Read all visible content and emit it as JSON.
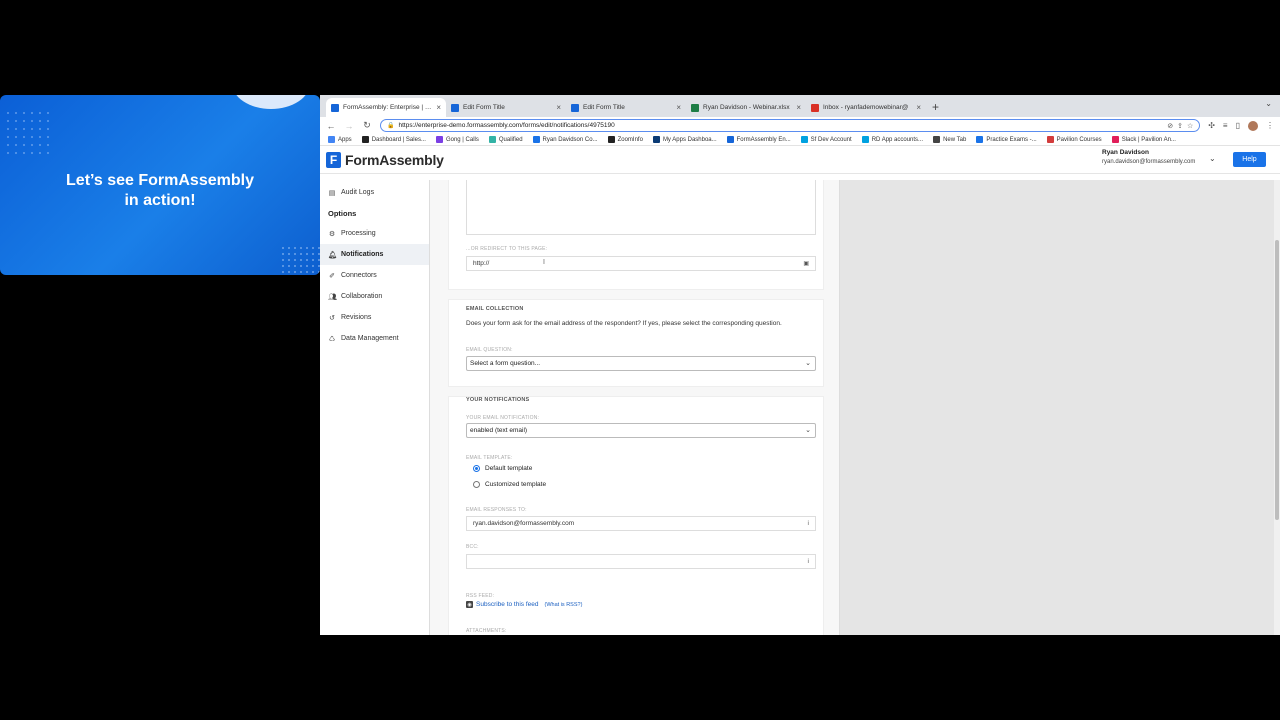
{
  "promo": {
    "line1": "Let’s see FormAssembly",
    "line2": "in action!"
  },
  "browser": {
    "tabs": [
      {
        "title": "FormAssembly: Enterprise | Fo",
        "icon": "formassembly-favicon",
        "color": "#1565d8",
        "active": true
      },
      {
        "title": "Edit Form Title",
        "icon": "formassembly-favicon",
        "color": "#1565d8",
        "active": false
      },
      {
        "title": "Edit Form Title",
        "icon": "formassembly-favicon",
        "color": "#1565d8",
        "active": false
      },
      {
        "title": "Ryan Davidson - Webinar.xlsx",
        "icon": "excel-favicon",
        "color": "#1e7d45",
        "active": false
      },
      {
        "title": "Inbox - ryanfademowebinar@",
        "icon": "gmail-favicon",
        "color": "#d93025",
        "active": false
      }
    ],
    "new_tab": "+",
    "url": "https://enterprise-demo.formassembly.com/forms/edit/notifications/4975190",
    "bookmarks": [
      {
        "label": "Apps",
        "color": "#4285f4"
      },
      {
        "label": "Dashboard | Sales...",
        "color": "#222"
      },
      {
        "label": "Gong | Calls",
        "color": "#7b3fe4"
      },
      {
        "label": "Qualified",
        "color": "#33b3a6"
      },
      {
        "label": "Ryan Davidson Co...",
        "color": "#1a73e8"
      },
      {
        "label": "ZoomInfo",
        "color": "#222"
      },
      {
        "label": "My Apps Dashboa...",
        "color": "#0b3b75"
      },
      {
        "label": "FormAssembly En...",
        "color": "#1565d8"
      },
      {
        "label": "Sf Dev Account",
        "color": "#00a1e0"
      },
      {
        "label": "RD App accounts...",
        "color": "#00a1e0"
      },
      {
        "label": "New Tab",
        "color": "#444"
      },
      {
        "label": "Practice Exams -...",
        "color": "#1a73e8"
      },
      {
        "label": "Pavilion Courses",
        "color": "#d23c3c"
      },
      {
        "label": "Slack | Pavilion An...",
        "color": "#e01e5a"
      }
    ]
  },
  "app": {
    "brand": "FormAssembly",
    "user_name": "Ryan Davidson",
    "user_email": "ryan.davidson@formassembly.com",
    "help_label": "Help"
  },
  "sidebar": {
    "audit_logs": "Audit Logs",
    "options_heading": "Options",
    "items": [
      {
        "label": "Processing",
        "icon": "gears-icon",
        "active": false
      },
      {
        "label": "Notifications",
        "icon": "bell-icon",
        "active": true
      },
      {
        "label": "Connectors",
        "icon": "plug-icon",
        "active": false
      },
      {
        "label": "Collaboration",
        "icon": "users-icon",
        "active": false
      },
      {
        "label": "Revisions",
        "icon": "history-icon",
        "active": false
      },
      {
        "label": "Data Management",
        "icon": "recycle-icon",
        "active": false
      }
    ]
  },
  "main": {
    "redirect_label": "...OR REDIRECT TO THIS PAGE:",
    "redirect_value": "http://",
    "email_collection": {
      "title": "EMAIL COLLECTION",
      "description": "Does your form ask for the email address of the respondent? If yes, please select the corresponding question.",
      "question_label": "EMAIL QUESTION:",
      "question_value": "Select a form question..."
    },
    "your_notifications": {
      "title": "YOUR NOTIFICATIONS",
      "notification_label": "YOUR EMAIL NOTIFICATION:",
      "notification_value": "enabled (text email)",
      "template_label": "EMAIL TEMPLATE:",
      "template_default": "Default template",
      "template_custom": "Customized template",
      "selected_template": "Default template",
      "responses_label": "EMAIL RESPONSES TO:",
      "responses_value": "ryan.davidson@formassembly.com",
      "bcc_label": "BCC:",
      "bcc_value": "",
      "rss_label": "RSS FEED:",
      "rss_link": "Subscribe to this feed",
      "rss_what": "(What is RSS?)",
      "attachments_label": "ATTACHMENTS:"
    }
  }
}
